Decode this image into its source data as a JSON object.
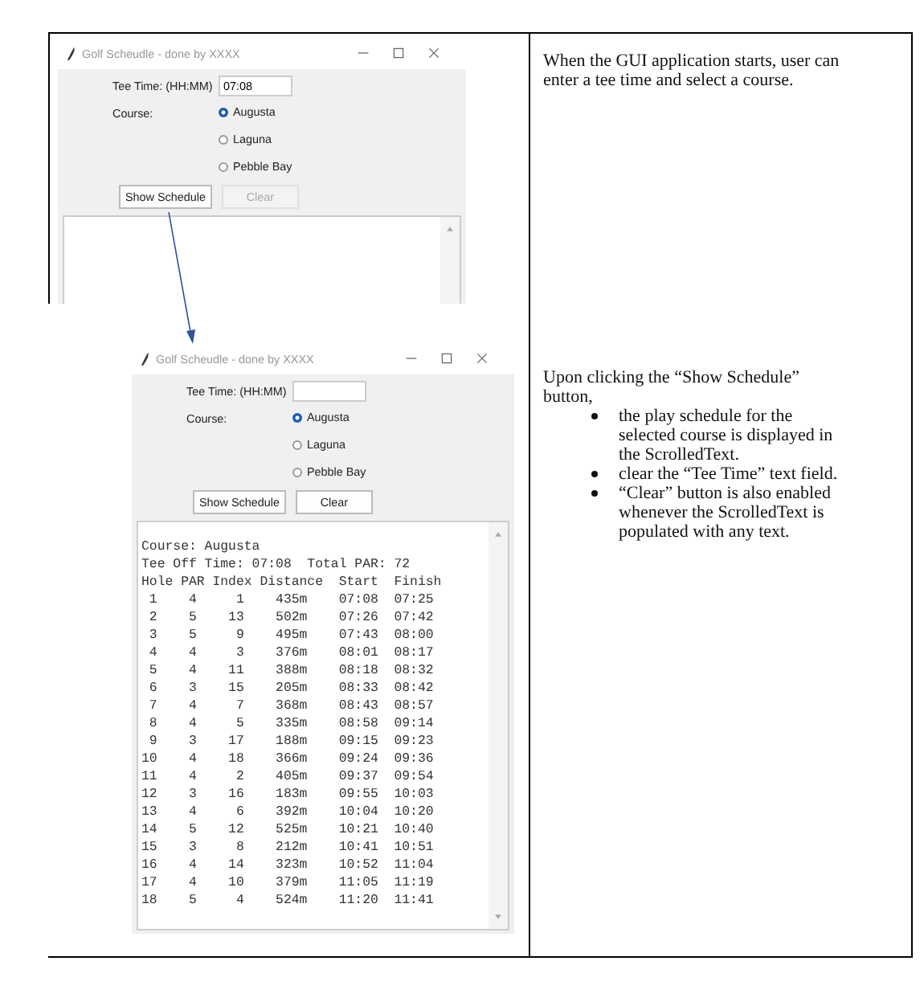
{
  "rows": [
    {
      "window": {
        "title": "Golf Scheudle - done by XXXX",
        "tee_time": {
          "label": "Tee Time: (HH:MM)",
          "value": "07:08"
        },
        "course": {
          "label": "Course:",
          "options": [
            {
              "label": "Augusta",
              "selected": true
            },
            {
              "label": "Laguna",
              "selected": false
            },
            {
              "label": "Pebble Bay",
              "selected": false
            }
          ]
        },
        "buttons": [
          {
            "label": "Show Schedule",
            "disabled": false
          },
          {
            "label": "Clear",
            "disabled": true
          }
        ]
      },
      "description": {
        "text": "When the GUI application starts, user can enter a tee time and select a course."
      }
    },
    {
      "window": {
        "title": "Golf Scheudle - done by XXXX",
        "tee_time": {
          "label": "Tee Time: (HH:MM)"
        },
        "course": {
          "label": "Course:",
          "options": [
            {
              "label": "Augusta",
              "selected": true
            },
            {
              "label": "Laguna",
              "selected": false
            },
            {
              "label": "Pebble Bay",
              "selected": false
            }
          ]
        },
        "buttons": [
          {
            "label": "Show Schedule",
            "disabled": false
          },
          {
            "label": "Clear",
            "disabled": false
          }
        ],
        "output": [
          "Course: Augusta",
          "Tee Off Time: 07:08  Total PAR: 72",
          "Hole PAR Index Distance  Start  Finish",
          " 1    4     1    435m    07:08  07:25",
          " 2    5    13    502m    07:26  07:42",
          " 3    5     9    495m    07:43  08:00",
          " 4    4     3    376m    08:01  08:17",
          " 5    4    11    388m    08:18  08:32",
          " 6    3    15    205m    08:33  08:42",
          " 7    4     7    368m    08:43  08:57",
          " 8    4     5    335m    08:58  09:14",
          " 9    3    17    188m    09:15  09:23",
          "10    4    18    366m    09:24  09:36",
          "11    4     2    405m    09:37  09:54",
          "12    3    16    183m    09:55  10:03",
          "13    4     6    392m    10:04  10:20",
          "14    5    12    525m    10:21  10:40",
          "15    3     8    212m    10:41  10:51",
          "16    4    14    323m    10:52  11:04",
          "17    4    10    379m    11:05  11:19",
          "18    5     4    524m    11:20  11:41"
        ]
      },
      "description": {
        "text": "Upon clicking the “Show Schedule” button,",
        "bullets": [
          "the play schedule for the selected course is displayed in the ScrolledText.",
          "clear the “Tee Time” text field.",
          "“Clear” button is also enabled whenever the ScrolledText is populated with any text."
        ]
      }
    }
  ]
}
